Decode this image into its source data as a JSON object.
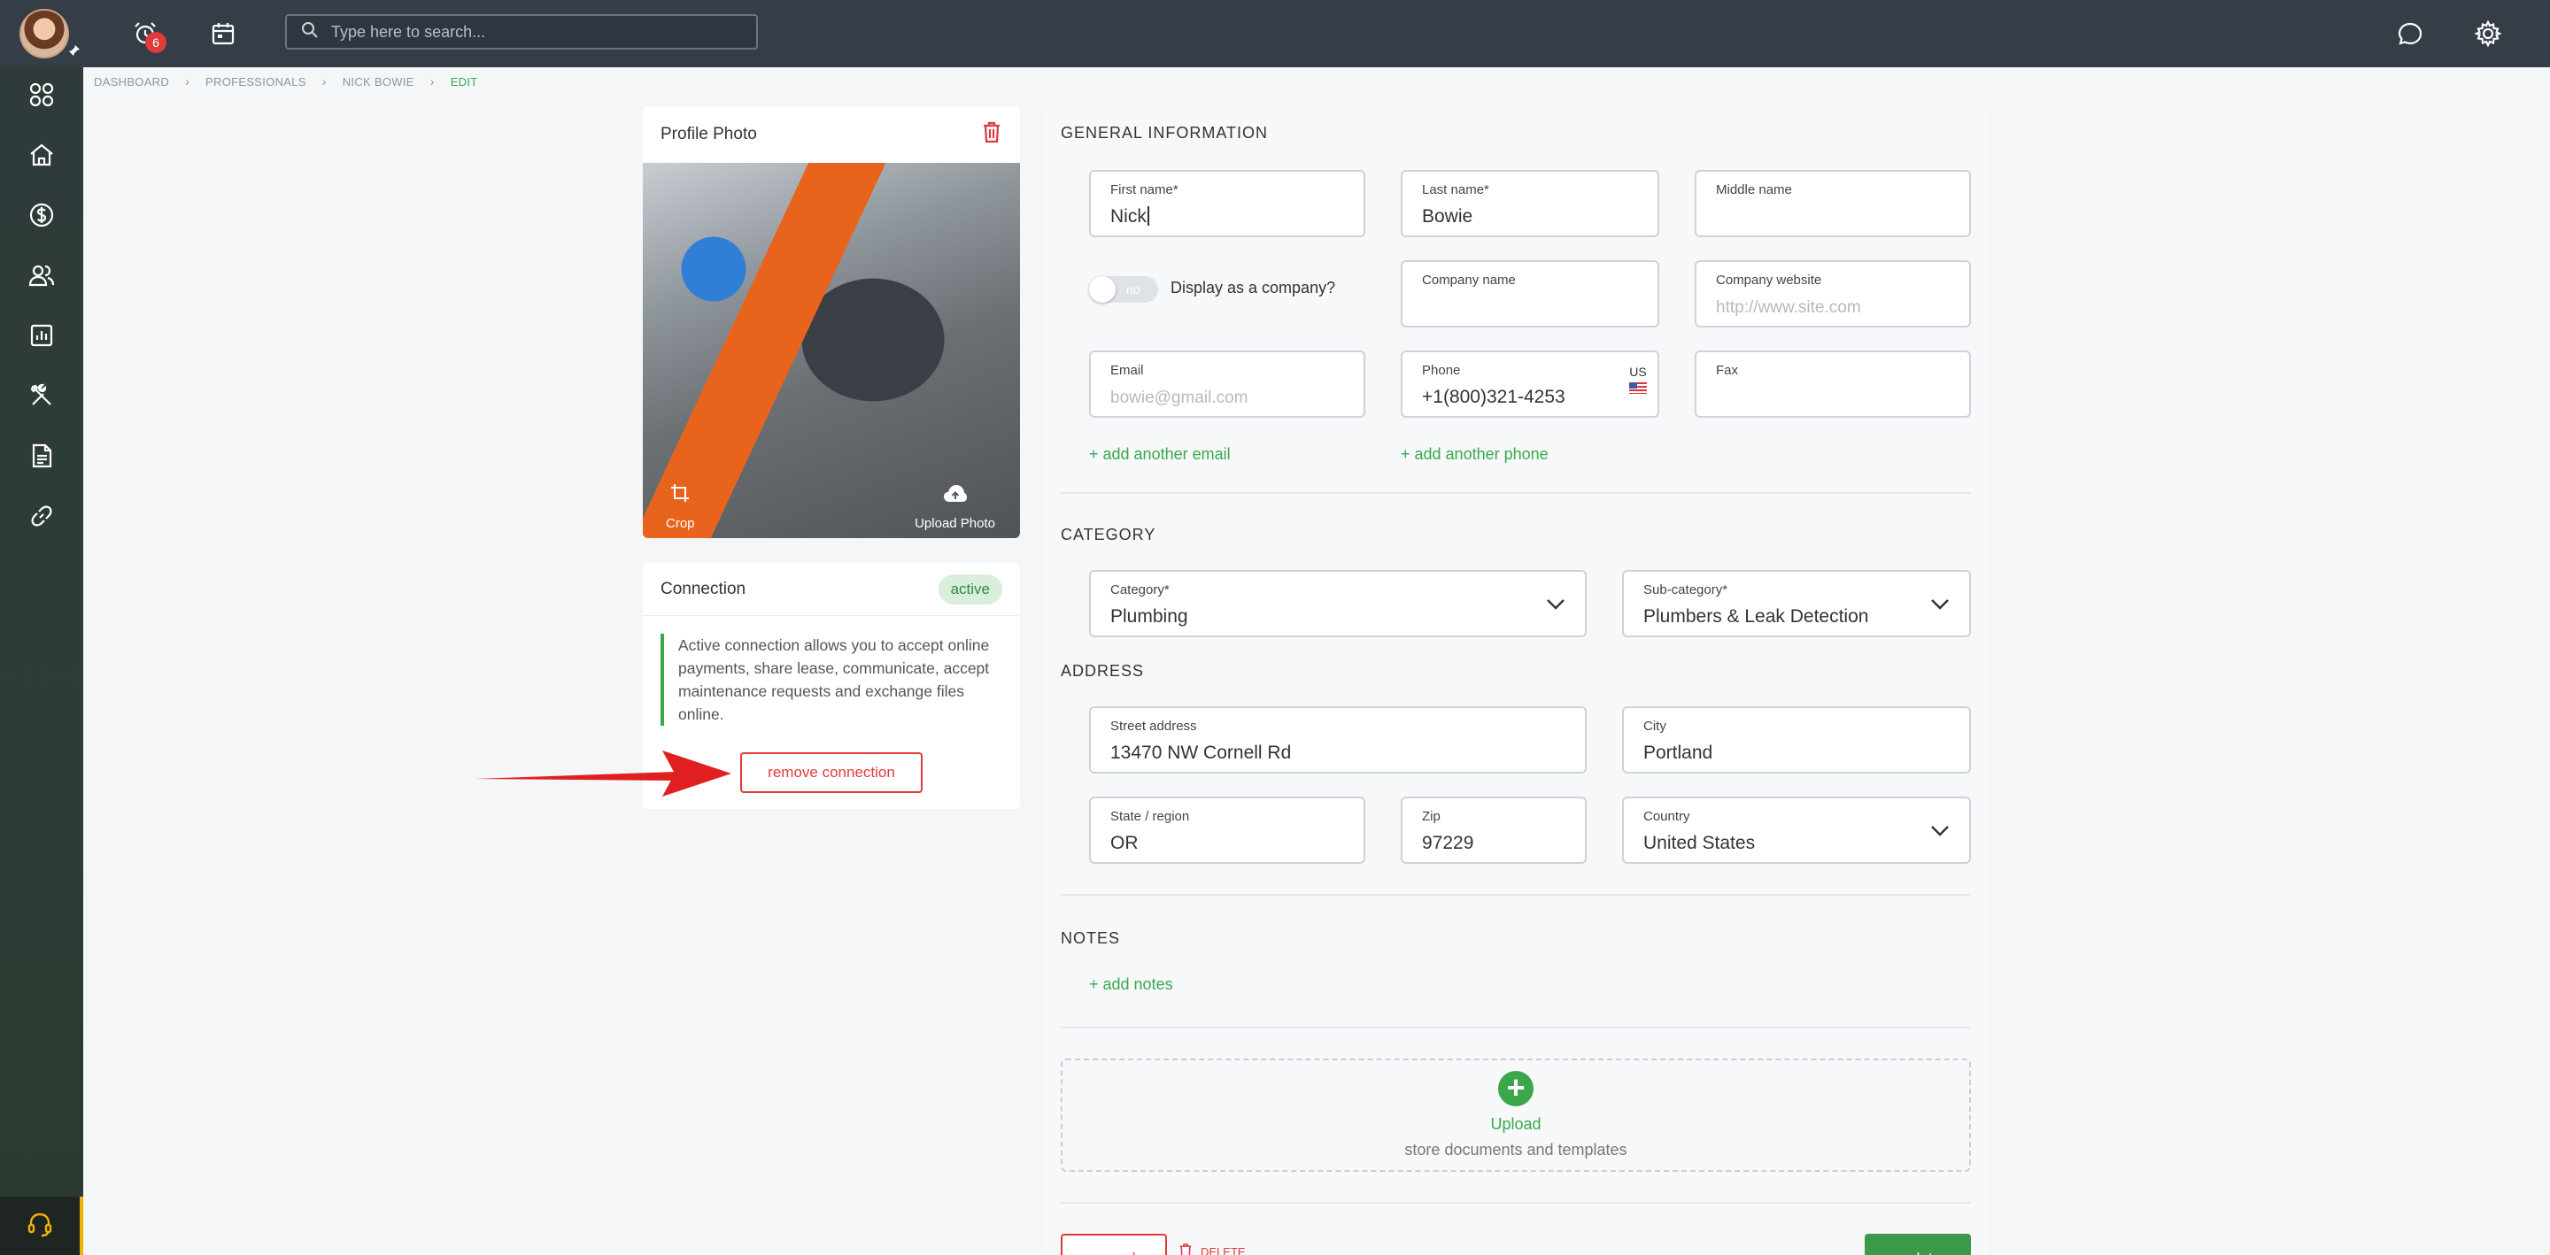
{
  "header": {
    "notification_count": "6",
    "search_placeholder": "Type here to search..."
  },
  "sidebar": {
    "items": [
      "dashboard-grid",
      "home",
      "payments",
      "users",
      "reports",
      "tools",
      "documents",
      "links"
    ]
  },
  "breadcrumb": {
    "items": [
      "DASHBOARD",
      "PROFESSIONALS",
      "NICK BOWIE"
    ],
    "current": "EDIT"
  },
  "profile_photo": {
    "title": "Profile Photo",
    "crop_label": "Crop",
    "upload_label": "Upload Photo"
  },
  "connection": {
    "title": "Connection",
    "status": "active",
    "description": "Active connection allows you to accept online payments, share lease, communicate, accept maintenance requests and exchange files online.",
    "remove_label": "remove connection"
  },
  "general": {
    "section_title": "GENERAL INFORMATION",
    "first_name_label": "First name*",
    "first_name": "Nick",
    "last_name_label": "Last name*",
    "last_name": "Bowie",
    "middle_name_label": "Middle name",
    "middle_name": "",
    "toggle_text": "no",
    "display_company_label": "Display as a company?",
    "company_name_label": "Company name",
    "company_name": "",
    "company_website_label": "Company website",
    "company_website_placeholder": "http://www.site.com",
    "email_label": "Email",
    "email_placeholder": "bowie@gmail.com",
    "phone_label": "Phone",
    "phone": "+1(800)321-4253",
    "phone_country": "US",
    "fax_label": "Fax",
    "fax": "",
    "add_email": "+ add another email",
    "add_phone": "+ add another phone"
  },
  "category": {
    "section_title": "CATEGORY",
    "category_label": "Category*",
    "category": "Plumbing",
    "subcategory_label": "Sub-category*",
    "subcategory": "Plumbers & Leak Detection"
  },
  "address": {
    "section_title": "ADDRESS",
    "street_label": "Street address",
    "street": "13470 NW Cornell Rd",
    "city_label": "City",
    "city": "Portland",
    "state_label": "State / region",
    "state": "OR",
    "zip_label": "Zip",
    "zip": "97229",
    "country_label": "Country",
    "country": "United States"
  },
  "notes": {
    "section_title": "NOTES",
    "add_notes": "+ add notes"
  },
  "upload": {
    "title": "Upload",
    "subtitle": "store documents and templates"
  },
  "actions": {
    "cancel": "cancel",
    "delete": "DELETE",
    "update": "update"
  },
  "colors": {
    "accent_green": "#3aa84a",
    "danger_red": "#e03a3a",
    "topbar": "#353d47"
  }
}
